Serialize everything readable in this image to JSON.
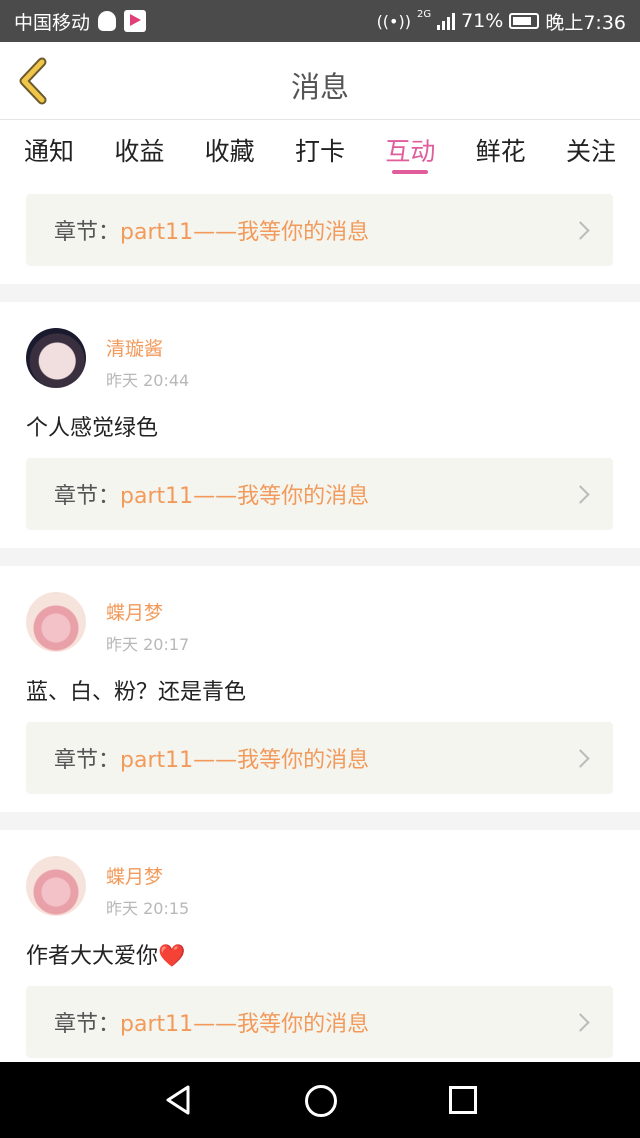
{
  "status_bar": {
    "carrier": "中国移动",
    "network_badge": "2G",
    "battery": "71%",
    "time": "晚上7:36",
    "icons": [
      "qq-icon",
      "app-icon",
      "wifi-icon",
      "signal-icon",
      "battery-icon"
    ]
  },
  "header": {
    "title": "消息",
    "back_icon": "back-chevron-icon",
    "accent_color": "#f0c64a"
  },
  "tabs": [
    {
      "label": "通知",
      "active": false
    },
    {
      "label": "收益",
      "active": false
    },
    {
      "label": "收藏",
      "active": false
    },
    {
      "label": "打卡",
      "active": false
    },
    {
      "label": "互动",
      "active": true
    },
    {
      "label": "鲜花",
      "active": false
    },
    {
      "label": "关注",
      "active": false
    }
  ],
  "colors": {
    "active_tab": "#e05c9a",
    "username": "#f29a5b",
    "chapter_title": "#f29a5b",
    "chapter_bg": "#f5f5ef"
  },
  "messages": [
    {
      "chapter_label": "章节：",
      "chapter_title": "part11——我等你的消息"
    },
    {
      "username": "清璇酱",
      "time": "昨天 20:44",
      "comment": "个人感觉绿色",
      "chapter_label": "章节：",
      "chapter_title": "part11——我等你的消息"
    },
    {
      "username": "蝶月梦",
      "time": "昨天 20:17",
      "comment": "蓝、白、粉？还是青色",
      "chapter_label": "章节：",
      "chapter_title": "part11——我等你的消息"
    },
    {
      "username": "蝶月梦",
      "time": "昨天 20:15",
      "comment": "作者大大爱你❤️",
      "chapter_label": "章节：",
      "chapter_title": "part11——我等你的消息"
    }
  ],
  "nav_bar": {
    "icons": [
      "back-triangle-icon",
      "home-circle-icon",
      "recent-square-icon"
    ]
  }
}
